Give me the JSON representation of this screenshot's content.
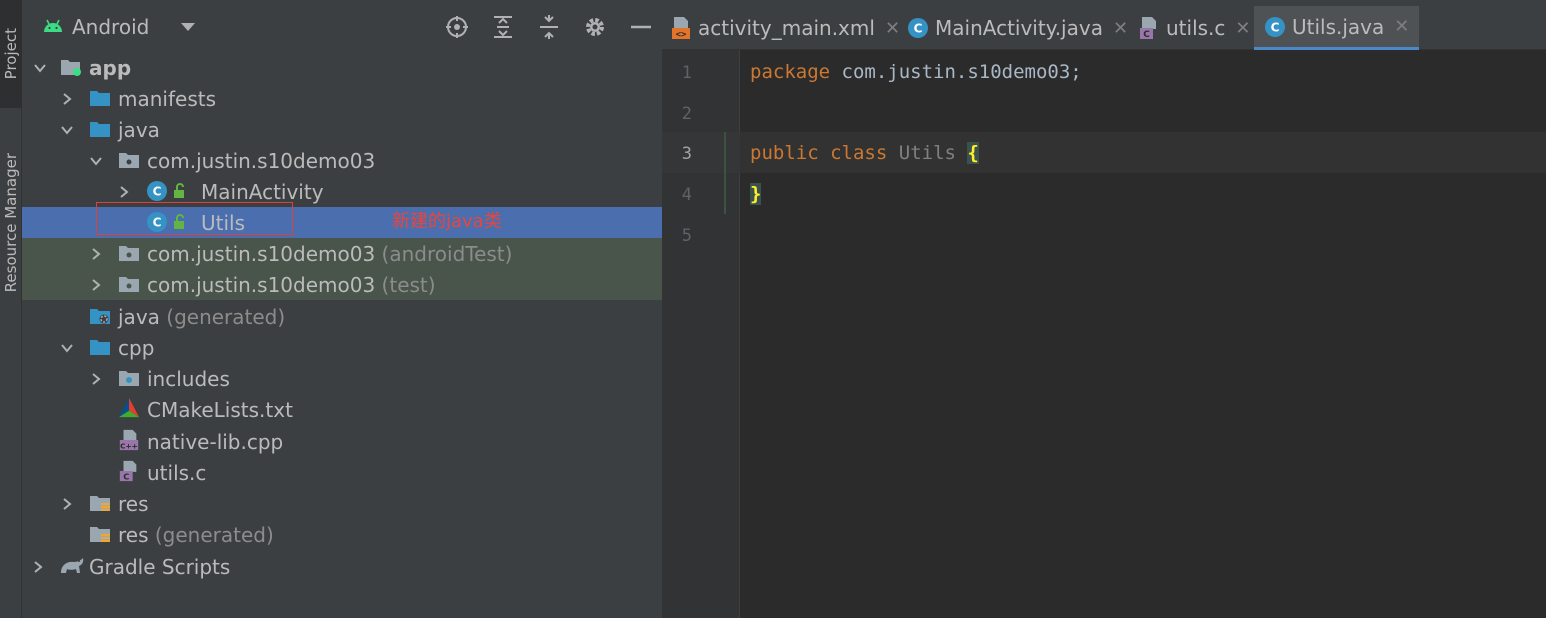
{
  "strip": {
    "project_label": "Project",
    "resource_manager_label": "Resource Manager"
  },
  "project_panel": {
    "view_mode": "Android",
    "toolbar": [
      "locate-icon",
      "expand-all-icon",
      "collapse-all-icon",
      "gear-icon",
      "minimize-icon"
    ],
    "tree": [
      {
        "label": "app",
        "suffix": "",
        "icon": "module-icon",
        "bold": true
      },
      {
        "label": "manifests",
        "suffix": "",
        "icon": "folder-icon"
      },
      {
        "label": "java",
        "suffix": "",
        "icon": "folder-icon"
      },
      {
        "label": "com.justin.s10demo03",
        "suffix": "",
        "icon": "package-icon"
      },
      {
        "label": "MainActivity",
        "suffix": "",
        "icon": "java-class-icon"
      },
      {
        "label": "Utils",
        "suffix": "",
        "icon": "java-class-icon"
      },
      {
        "label": "com.justin.s10demo03",
        "suffix": " (androidTest)",
        "icon": "package-icon"
      },
      {
        "label": "com.justin.s10demo03",
        "suffix": " (test)",
        "icon": "package-icon"
      },
      {
        "label": "java",
        "suffix": " (generated)",
        "icon": "generated-folder-icon"
      },
      {
        "label": "cpp",
        "suffix": "",
        "icon": "folder-icon"
      },
      {
        "label": "includes",
        "suffix": "",
        "icon": "include-folder-icon"
      },
      {
        "label": "CMakeLists.txt",
        "suffix": "",
        "icon": "cmake-icon"
      },
      {
        "label": "native-lib.cpp",
        "suffix": "",
        "icon": "cpp-file-icon"
      },
      {
        "label": "utils.c",
        "suffix": "",
        "icon": "c-file-icon"
      },
      {
        "label": "res",
        "suffix": "",
        "icon": "res-folder-icon"
      },
      {
        "label": "res",
        "suffix": " (generated)",
        "icon": "res-folder-icon"
      },
      {
        "label": "Gradle Scripts",
        "suffix": "",
        "icon": "gradle-icon"
      }
    ],
    "annotation": "新建的java类"
  },
  "editor": {
    "tabs": [
      {
        "label": "activity_main.xml",
        "icon": "xml-file-icon",
        "active": false
      },
      {
        "label": "MainActivity.java",
        "icon": "java-class-icon",
        "active": false
      },
      {
        "label": "utils.c",
        "icon": "c-file-icon",
        "active": false
      },
      {
        "label": "Utils.java",
        "icon": "java-class-icon",
        "active": true
      }
    ],
    "line_numbers": [
      "1",
      "2",
      "3",
      "4",
      "5"
    ],
    "code": {
      "l1_kw": "package",
      "l1_rest": " com.justin.s10demo03;",
      "l3_kw1": "public",
      "l3_kw2": "class",
      "l3_cls": "Utils",
      "l3_brace": "{",
      "l4_brace": "}"
    }
  },
  "colors": {
    "selected_row": "#4b6eaf",
    "test_row": "#49544a",
    "keyword": "#cc7832",
    "annotation": "#e8463c"
  }
}
